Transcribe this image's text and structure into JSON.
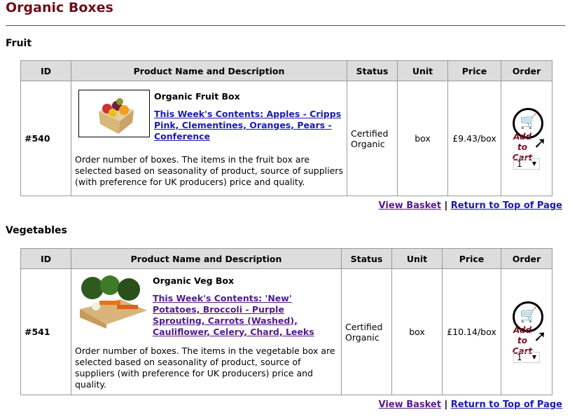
{
  "page": {
    "title": "Organic Boxes"
  },
  "headers": [
    "ID",
    "Product Name and Description",
    "Status",
    "Unit",
    "Price",
    "Order"
  ],
  "sections": [
    {
      "heading": "Fruit",
      "product": {
        "id": "#540",
        "name": "Organic Fruit Box",
        "contents_link": "This Week's Contents:  Apples - Cripps Pink, Clementines, Oranges, Pears - Conference",
        "description": "Order number of boxes. The items in the fruit box are selected based on seasonality of product, source of suppliers (with preference for UK producers) price and quality.",
        "status": "Certified Organic",
        "unit": "box",
        "price": "£9.43/box",
        "add_to_cart": "Add to Cart",
        "quantity": "1"
      }
    },
    {
      "heading": "Vegetables",
      "product": {
        "id": "#541",
        "name": "Organic Veg Box",
        "contents_link": "This Week's Contents:  'New' Potatoes, Broccoli - Purple Sprouting, Carrots (Washed), Cauliflower, Celery, Chard, Leeks",
        "description": "Order number of boxes. The items in the vegetable box are selected based on seasonality of product, source of suppliers (with preference for UK producers) price and quality.",
        "status": "Certified Organic",
        "unit": "box",
        "price": "£10.14/box",
        "add_to_cart": "Add to Cart",
        "quantity": "1"
      }
    }
  ],
  "links": {
    "view_basket": "View Basket",
    "separator": "|",
    "return_top": "Return to Top of Page"
  },
  "colors": {
    "title": "#6b0f1a",
    "link": "#1a1ab0",
    "visited_link": "#551a8b",
    "header_bg": "#dddddd"
  }
}
